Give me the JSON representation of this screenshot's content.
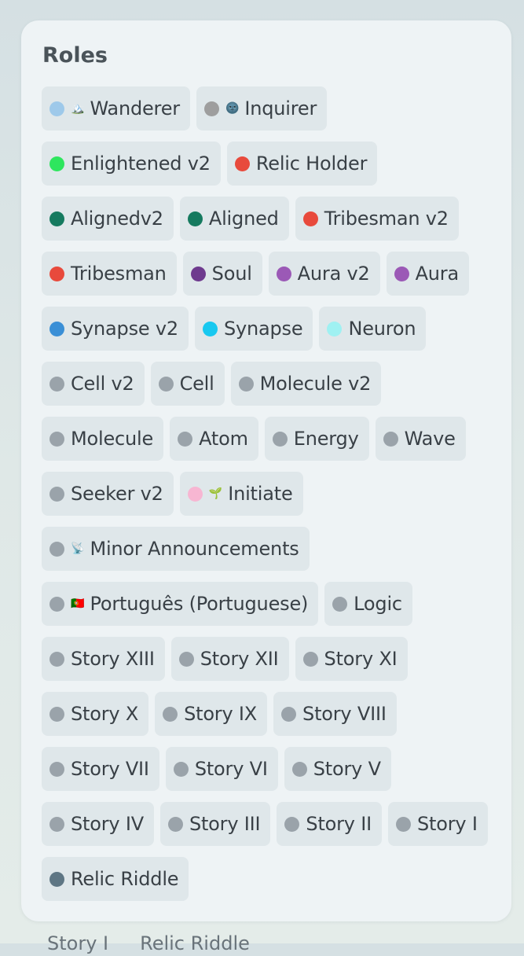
{
  "panel": {
    "title": "Roles"
  },
  "roles": [
    {
      "name": "Wanderer",
      "color": "#9ec9ea",
      "icon": "🏔️",
      "icon_name": "mountain-icon"
    },
    {
      "name": "Inquirer",
      "color": "#9e9e9e",
      "icon": "🌚",
      "icon_name": "moon-face-icon"
    },
    {
      "name": "Enlightened v2",
      "color": "#2ee65e",
      "icon": "",
      "icon_name": ""
    },
    {
      "name": "Relic Holder",
      "color": "#e84a3c",
      "icon": "",
      "icon_name": ""
    },
    {
      "name": "Alignedv2",
      "color": "#157a5f",
      "icon": "",
      "icon_name": ""
    },
    {
      "name": "Aligned",
      "color": "#157a5f",
      "icon": "",
      "icon_name": ""
    },
    {
      "name": "Tribesman v2",
      "color": "#e84a3c",
      "icon": "",
      "icon_name": ""
    },
    {
      "name": "Tribesman",
      "color": "#e84a3c",
      "icon": "",
      "icon_name": ""
    },
    {
      "name": "Soul",
      "color": "#6e3a8e",
      "icon": "",
      "icon_name": ""
    },
    {
      "name": "Aura v2",
      "color": "#9b59b6",
      "icon": "",
      "icon_name": ""
    },
    {
      "name": "Aura",
      "color": "#9b59b6",
      "icon": "",
      "icon_name": ""
    },
    {
      "name": "Synapse v2",
      "color": "#3a8fd6",
      "icon": "",
      "icon_name": ""
    },
    {
      "name": "Synapse",
      "color": "#18c8f0",
      "icon": "",
      "icon_name": ""
    },
    {
      "name": "Neuron",
      "color": "#9ff1f2",
      "icon": "",
      "icon_name": ""
    },
    {
      "name": "Cell v2",
      "color": "#9aa3aa",
      "icon": "",
      "icon_name": ""
    },
    {
      "name": "Cell",
      "color": "#9aa3aa",
      "icon": "",
      "icon_name": ""
    },
    {
      "name": "Molecule v2",
      "color": "#9aa3aa",
      "icon": "",
      "icon_name": ""
    },
    {
      "name": "Molecule",
      "color": "#9aa3aa",
      "icon": "",
      "icon_name": ""
    },
    {
      "name": "Atom",
      "color": "#9aa3aa",
      "icon": "",
      "icon_name": ""
    },
    {
      "name": "Energy",
      "color": "#9aa3aa",
      "icon": "",
      "icon_name": ""
    },
    {
      "name": "Wave",
      "color": "#9aa3aa",
      "icon": "",
      "icon_name": ""
    },
    {
      "name": "Seeker v2",
      "color": "#9aa3aa",
      "icon": "",
      "icon_name": ""
    },
    {
      "name": "Initiate",
      "color": "#f7b6d2",
      "icon": "🌱",
      "icon_name": "seedling-icon"
    },
    {
      "name": "Minor Announcements",
      "color": "#9aa3aa",
      "icon": "📡",
      "icon_name": "satellite-dish-icon"
    },
    {
      "name": "Português (Portuguese)",
      "color": "#9aa3aa",
      "icon": "🇵🇹",
      "icon_name": "portugal-flag-icon"
    },
    {
      "name": "Logic",
      "color": "#9aa3aa",
      "icon": "",
      "icon_name": ""
    },
    {
      "name": "Story XIII",
      "color": "#9aa3aa",
      "icon": "",
      "icon_name": ""
    },
    {
      "name": "Story XII",
      "color": "#9aa3aa",
      "icon": "",
      "icon_name": ""
    },
    {
      "name": "Story XI",
      "color": "#9aa3aa",
      "icon": "",
      "icon_name": ""
    },
    {
      "name": "Story X",
      "color": "#9aa3aa",
      "icon": "",
      "icon_name": ""
    },
    {
      "name": "Story IX",
      "color": "#9aa3aa",
      "icon": "",
      "icon_name": ""
    },
    {
      "name": "Story VIII",
      "color": "#9aa3aa",
      "icon": "",
      "icon_name": ""
    },
    {
      "name": "Story VII",
      "color": "#9aa3aa",
      "icon": "",
      "icon_name": ""
    },
    {
      "name": "Story VI",
      "color": "#9aa3aa",
      "icon": "",
      "icon_name": ""
    },
    {
      "name": "Story V",
      "color": "#9aa3aa",
      "icon": "",
      "icon_name": ""
    },
    {
      "name": "Story IV",
      "color": "#9aa3aa",
      "icon": "",
      "icon_name": ""
    },
    {
      "name": "Story III",
      "color": "#9aa3aa",
      "icon": "",
      "icon_name": ""
    },
    {
      "name": "Story II",
      "color": "#9aa3aa",
      "icon": "",
      "icon_name": ""
    },
    {
      "name": "Story I",
      "color": "#9aa3aa",
      "icon": "",
      "icon_name": ""
    },
    {
      "name": "Relic Riddle",
      "color": "#5e7684",
      "icon": "",
      "icon_name": ""
    }
  ],
  "peek": {
    "left": "Story I",
    "right": "Relic Riddle"
  }
}
